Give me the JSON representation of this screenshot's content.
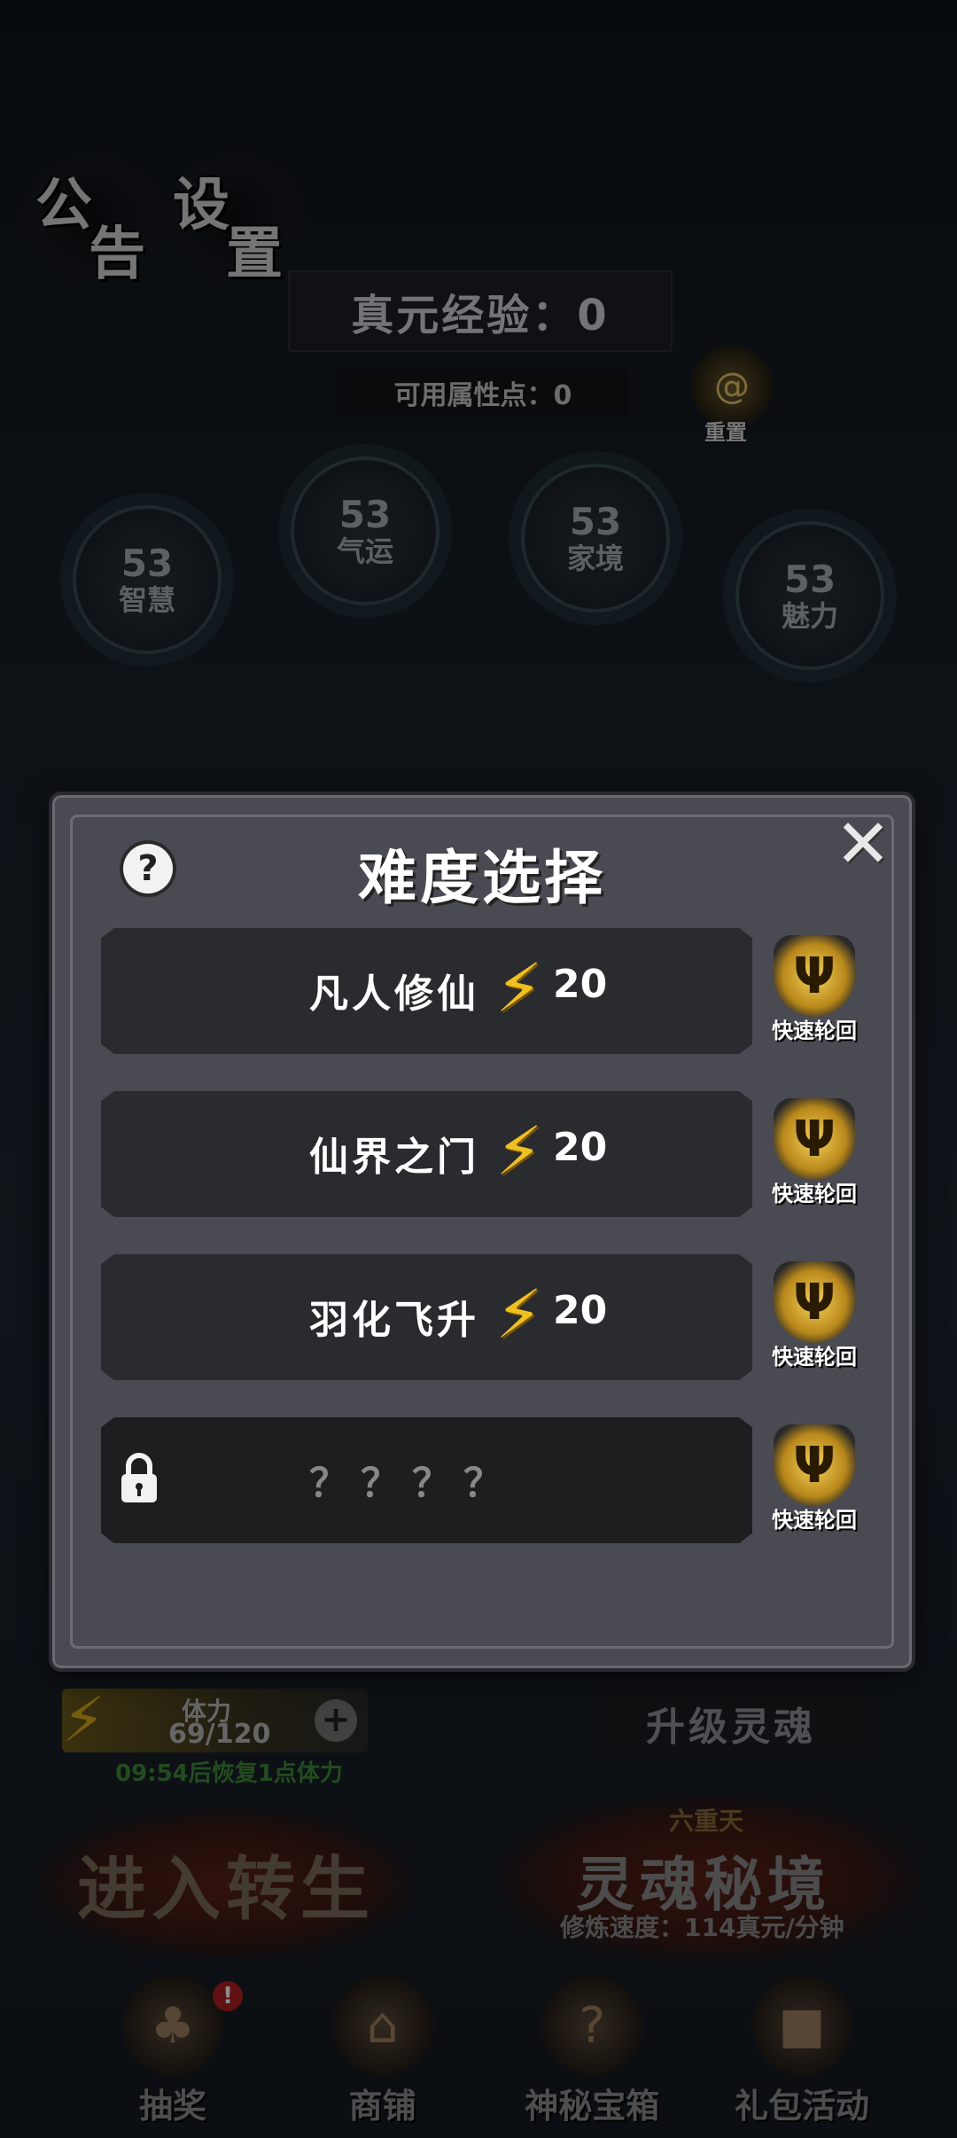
{
  "top_tabs": {
    "notice": [
      "公",
      "告"
    ],
    "settings": [
      "设",
      "置"
    ]
  },
  "exp": {
    "label": "真元经验：0"
  },
  "attr_points": {
    "label": "可用属性点：0"
  },
  "reset": {
    "label": "重置",
    "icon": "swirl-icon"
  },
  "stats": [
    {
      "value": "53",
      "label": "智慧"
    },
    {
      "value": "53",
      "label": "气运"
    },
    {
      "value": "53",
      "label": "家境"
    },
    {
      "value": "53",
      "label": "魅力"
    }
  ],
  "stamina": {
    "label": "体力",
    "value": "69/120",
    "recover": "09:54后恢复1点体力"
  },
  "upgrade_soul": "升级灵魂",
  "enter_rebirth": "进入转生",
  "soul_realm": {
    "tier": "六重天",
    "name": "灵魂秘境",
    "speed": "修炼速度：114真元/分钟"
  },
  "bottom_nav": [
    {
      "label": "抽奖",
      "icon": "lottery-icon",
      "badge": "!"
    },
    {
      "label": "商铺",
      "icon": "shop-icon"
    },
    {
      "label": "神秘宝箱",
      "icon": "chest-icon"
    },
    {
      "label": "礼包活动",
      "icon": "gift-icon"
    }
  ],
  "modal": {
    "title": "难度选择",
    "help_icon": "?",
    "close_icon": "✕",
    "rows": [
      {
        "name": "凡人修仙",
        "cost": "20",
        "locked": false
      },
      {
        "name": "仙界之门",
        "cost": "20",
        "locked": false
      },
      {
        "name": "羽化飞升",
        "cost": "20",
        "locked": false
      },
      {
        "name": "？？？？",
        "locked": true
      }
    ],
    "fast_button_label": "快速轮回"
  },
  "colors": {
    "accent_gold": "#f0c020",
    "modal_bg": "#4a4b52",
    "row_bg": "#2a2b2f"
  }
}
